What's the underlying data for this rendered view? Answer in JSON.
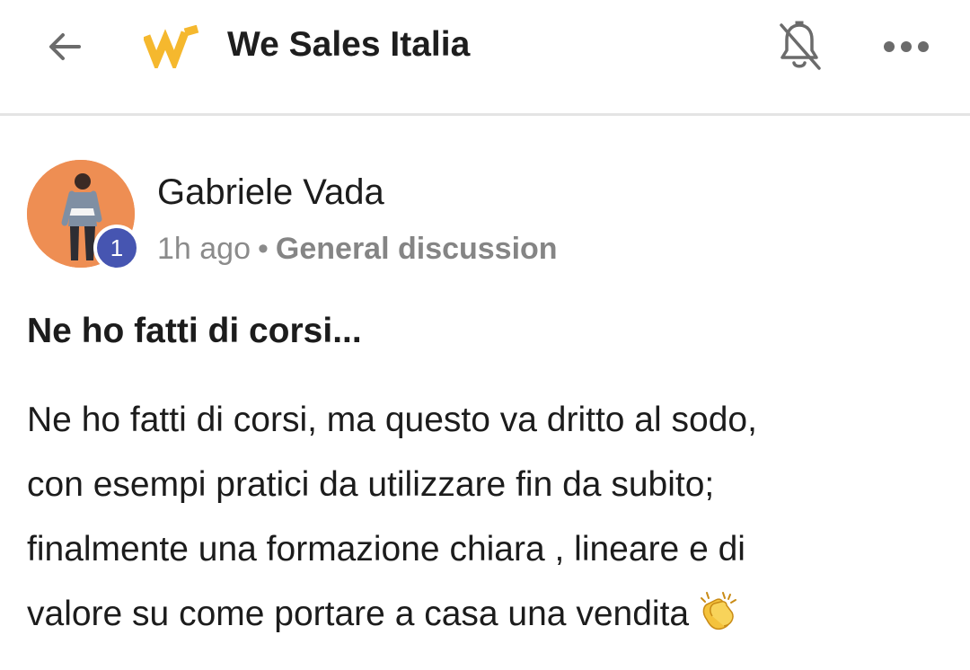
{
  "header": {
    "title": "We Sales Italia",
    "back_icon": "arrow-left-icon",
    "logo_icon": "we-sales-logo",
    "bell_icon": "bell-off-icon",
    "more_icon": "more-horizontal-icon",
    "logo_color": "#f5b82e",
    "icon_color": "#6b6b6b"
  },
  "post": {
    "author": "Gabriele Vada",
    "badge": "1",
    "time": "1h ago",
    "separator": "•",
    "channel": "General discussion",
    "title": "Ne ho fatti di corsi...",
    "body_lines": [
      "Ne ho fatti di corsi, ma questo va dritto al sodo,",
      "con esempi pratici da utilizzare fin da subito;",
      "finalmente una formazione chiara , lineare e di",
      "valore su come portare a casa una vendita"
    ],
    "trailing_emoji": "clapping-hands-icon",
    "avatar_bg": "#ee8e53",
    "badge_color": "#4655b1"
  }
}
